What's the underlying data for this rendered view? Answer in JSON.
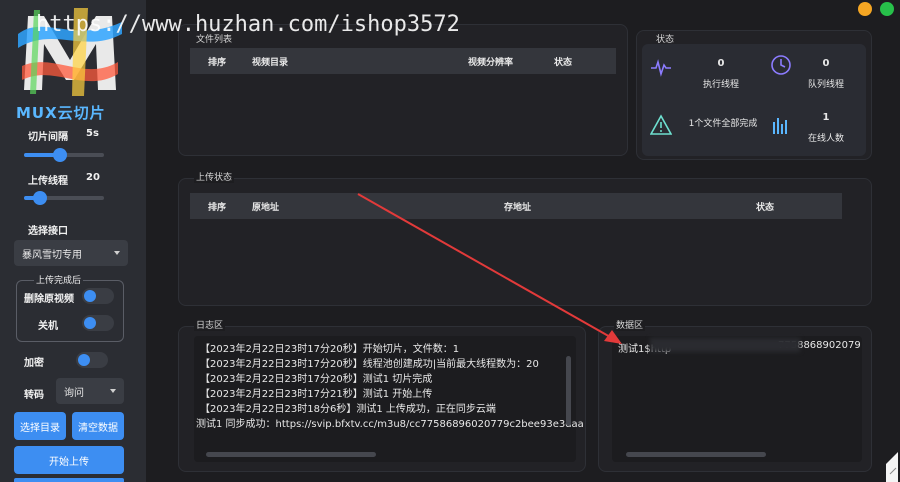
{
  "app": {
    "logo_text": "MUX云切片",
    "watermark": "https://www.huzhan.com/ishop3572"
  },
  "sidebar": {
    "slice_interval_label": "切片间隔",
    "slice_interval_value": "5s",
    "slice_interval_fraction": 0.45,
    "upload_threads_label": "上传线程",
    "upload_threads_value": "20",
    "upload_threads_fraction": 0.2,
    "select_api_label": "选择接口",
    "api_selected": "暴风雪切专用",
    "after_upload_label": "上传完成后",
    "delete_video_label": "删除原视频",
    "shutdown_label": "关机",
    "encrypt_label": "加密",
    "transcode_label": "转码",
    "transcode_selected": "询问",
    "select_dir_button": "选择目录",
    "clear_data_button": "清空数据",
    "start_upload_button": "开始上传"
  },
  "file_list": {
    "title": "文件列表",
    "columns": [
      "排序",
      "视频目录",
      "视频分辨率",
      "状态"
    ]
  },
  "status": {
    "title": "状态",
    "exec_threads_value": "0",
    "exec_threads_label": "执行线程",
    "queue_threads_value": "0",
    "queue_threads_label": "队列线程",
    "files_done_label": "1个文件全部完成",
    "online_value": "1",
    "online_label": "在线人数"
  },
  "upload_status": {
    "title": "上传状态",
    "columns": [
      "排序",
      "原地址",
      "存地址",
      "状态"
    ]
  },
  "log": {
    "title": "日志区",
    "lines": [
      "【2023年2月22日23时17分20秒】开始切片，文件数：1",
      "【2023年2月22日23时17分20秒】线程池创建成功|当前最大线程数为：20",
      "【2023年2月22日23时17分20秒】测试1 切片完成",
      "【2023年2月22日23时17分21秒】测试1 开始上传",
      "【2023年2月22日23时18分6秒】测试1 上传成功，正在同步云端",
      "测试1 同步成功：https://svip.bfxtv.cc/m3u8/cc77586896020779c2bee93e3daa"
    ]
  },
  "data_area": {
    "title": "数据区",
    "line_start": "测试1$http",
    "line_end": "7758868902079"
  },
  "colors": {
    "accent": "#3d8ef2",
    "window_yellow": "#f5a623",
    "window_green": "#27c04a"
  }
}
